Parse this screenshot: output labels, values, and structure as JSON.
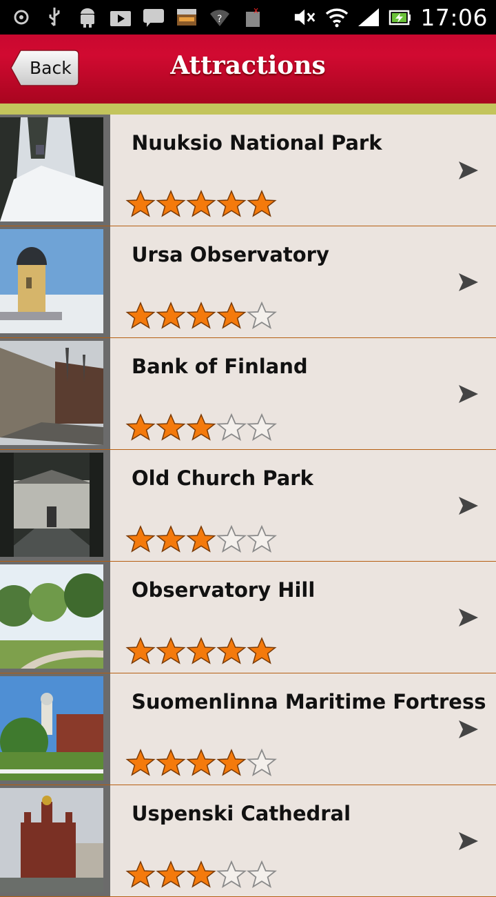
{
  "status_bar": {
    "time": "17:06",
    "left_icons": [
      "gps-icon",
      "usb-icon",
      "android-icon",
      "play-store-icon",
      "chat-icon",
      "amazon-icon",
      "wifi-question-icon",
      "sim-error-icon"
    ],
    "right_icons": [
      "mute-icon",
      "wifi-icon",
      "signal-icon",
      "battery-charging-icon"
    ]
  },
  "header": {
    "back_label": "Back",
    "title": "Attractions"
  },
  "colors": {
    "header_red": "#c9082f",
    "accent_bar": "#c3c45c",
    "row_background": "#ebe4df",
    "row_divider": "#b55e10",
    "star_orange": "#f47a0c"
  },
  "attractions": [
    {
      "name": "Nuuksio National Park",
      "rating": 5
    },
    {
      "name": "Ursa Observatory",
      "rating": 4
    },
    {
      "name": "Bank of Finland",
      "rating": 3
    },
    {
      "name": "Old Church Park",
      "rating": 3
    },
    {
      "name": "Observatory Hill",
      "rating": 5
    },
    {
      "name": "Suomenlinna Maritime Fortress",
      "rating": 4
    },
    {
      "name": "Uspenski Cathedral",
      "rating": 3
    }
  ]
}
